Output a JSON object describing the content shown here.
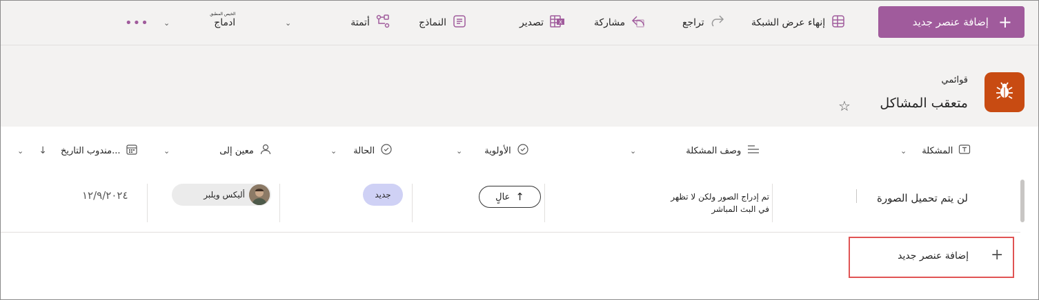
{
  "toolbar": {
    "add_new_item": "إضافة عنصر جديد",
    "end_grid_view": "إنهاء عرض الشبكة",
    "undo": "تراجع",
    "share": "مشاركة",
    "export": "تصدير",
    "forms": "النماذج",
    "automate": "أتمتة",
    "integrate": "ادماج",
    "integrate_sup": "الخيص المطبق",
    "more_icon": "more-horizontal-icon"
  },
  "header": {
    "breadcrumb": "قوائمي",
    "title": "متعقب المشاكل",
    "app_icon": "bug-icon",
    "accent": "#c84b12"
  },
  "columns": [
    {
      "key": "issue",
      "label": "المشكلة",
      "icon": "text-field-icon"
    },
    {
      "key": "description",
      "label": "وصف المشكلة",
      "icon": "multiline-text-icon"
    },
    {
      "key": "priority",
      "label": "الأولوية",
      "icon": "choice-icon"
    },
    {
      "key": "status",
      "label": "الحالة",
      "icon": "choice-icon"
    },
    {
      "key": "assigned",
      "label": "معين إلى",
      "icon": "person-icon"
    },
    {
      "key": "due",
      "label": "مندوب التاريخ...",
      "icon": "calendar-icon"
    }
  ],
  "rows": [
    {
      "issue": "لن يتم تحميل الصورة",
      "description_line1": "تم إدراج الصور ولكن لا تظهر",
      "description_line2": "في البث المباشر",
      "priority": "عالٍ",
      "status": "جديد",
      "assigned": "أليكس ويلبر",
      "due": "١٢/٩/٢٠٢٤"
    }
  ],
  "add_row_label": "إضافة عنصر جديد",
  "colors": {
    "brand_button": "#a05b9c",
    "status_pill": "#cfd1f5",
    "highlight_border": "#e05353"
  }
}
